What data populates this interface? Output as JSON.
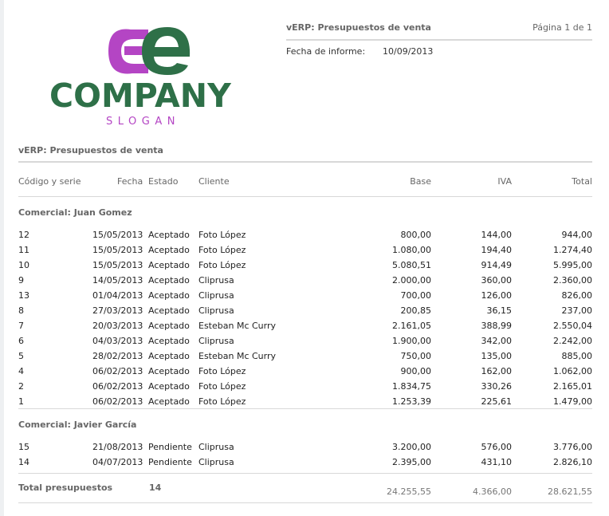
{
  "logo": {
    "company": "COMPANY",
    "slogan": "SLOGAN",
    "colors": {
      "green": "#2e7048",
      "purple": "#b445c4"
    }
  },
  "header": {
    "title": "vERP: Presupuestos de venta",
    "page": "Página 1 de 1",
    "date_label": "Fecha de informe:",
    "date_value": "10/09/2013"
  },
  "section_title": "vERP: Presupuestos de venta",
  "columns": {
    "code": "Código y serie",
    "date": "Fecha",
    "status": "Estado",
    "client": "Cliente",
    "base": "Base",
    "iva": "IVA",
    "total": "Total"
  },
  "groups": [
    {
      "title": "Comercial: Juan Gomez",
      "rows": [
        {
          "code": "12",
          "date": "15/05/2013",
          "status": "Aceptado",
          "client": "Foto López",
          "base": "800,00",
          "iva": "144,00",
          "total": "944,00"
        },
        {
          "code": "11",
          "date": "15/05/2013",
          "status": "Aceptado",
          "client": "Foto López",
          "base": "1.080,00",
          "iva": "194,40",
          "total": "1.274,40"
        },
        {
          "code": "10",
          "date": "15/05/2013",
          "status": "Aceptado",
          "client": "Foto López",
          "base": "5.080,51",
          "iva": "914,49",
          "total": "5.995,00"
        },
        {
          "code": "9",
          "date": "14/05/2013",
          "status": "Aceptado",
          "client": "Cliprusa",
          "base": "2.000,00",
          "iva": "360,00",
          "total": "2.360,00"
        },
        {
          "code": "13",
          "date": "01/04/2013",
          "status": "Aceptado",
          "client": "Cliprusa",
          "base": "700,00",
          "iva": "126,00",
          "total": "826,00"
        },
        {
          "code": "8",
          "date": "27/03/2013",
          "status": "Aceptado",
          "client": "Cliprusa",
          "base": "200,85",
          "iva": "36,15",
          "total": "237,00"
        },
        {
          "code": "7",
          "date": "20/03/2013",
          "status": "Aceptado",
          "client": "Esteban Mc Curry",
          "base": "2.161,05",
          "iva": "388,99",
          "total": "2.550,04"
        },
        {
          "code": "6",
          "date": "04/03/2013",
          "status": "Aceptado",
          "client": "Cliprusa",
          "base": "1.900,00",
          "iva": "342,00",
          "total": "2.242,00"
        },
        {
          "code": "5",
          "date": "28/02/2013",
          "status": "Aceptado",
          "client": "Esteban Mc Curry",
          "base": "750,00",
          "iva": "135,00",
          "total": "885,00"
        },
        {
          "code": "4",
          "date": "06/02/2013",
          "status": "Aceptado",
          "client": "Foto López",
          "base": "900,00",
          "iva": "162,00",
          "total": "1.062,00"
        },
        {
          "code": "2",
          "date": "06/02/2013",
          "status": "Aceptado",
          "client": "Foto López",
          "base": "1.834,75",
          "iva": "330,26",
          "total": "2.165,01"
        },
        {
          "code": "1",
          "date": "06/02/2013",
          "status": "Aceptado",
          "client": "Foto López",
          "base": "1.253,39",
          "iva": "225,61",
          "total": "1.479,00"
        }
      ]
    },
    {
      "title": "Comercial: Javier García",
      "rows": [
        {
          "code": "15",
          "date": "21/08/2013",
          "status": "Pendiente",
          "client": "Cliprusa",
          "base": "3.200,00",
          "iva": "576,00",
          "total": "3.776,00"
        },
        {
          "code": "14",
          "date": "04/07/2013",
          "status": "Pendiente",
          "client": "Cliprusa",
          "base": "2.395,00",
          "iva": "431,10",
          "total": "2.826,10"
        }
      ]
    }
  ],
  "totals": {
    "label": "Total presupuestos",
    "count": "14",
    "base": "24.255,55",
    "iva": "4.366,00",
    "total": "28.621,55"
  }
}
